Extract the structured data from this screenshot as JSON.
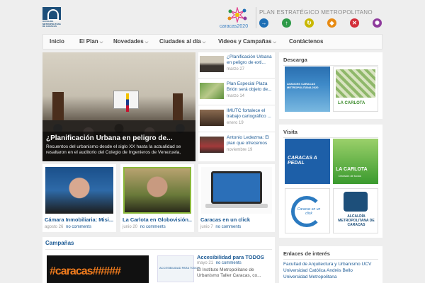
{
  "header": {
    "logo_text": "ALCALDÍA METROPOLITANA DE CARACAS",
    "plan_logo_text": "caracas2020",
    "plan_title": "PLAN ESTRATÉGICO METROPOLITANO",
    "plan_icons": [
      {
        "icon": "arrow-right-icon",
        "color": "#1e6fb5"
      },
      {
        "icon": "arrow-up-icon",
        "color": "#2e9a48"
      },
      {
        "icon": "cycle-icon",
        "color": "#c9b800"
      },
      {
        "icon": "diamond-up-icon",
        "color": "#e78a12"
      },
      {
        "icon": "cross-diamond-icon",
        "color": "#d32e3a"
      },
      {
        "icon": "gear-icon",
        "color": "#8e3a9c"
      }
    ]
  },
  "nav": {
    "items": [
      {
        "label": "Inicio",
        "has_dropdown": false
      },
      {
        "label": "El Plan",
        "has_dropdown": true
      },
      {
        "label": "Novedades",
        "has_dropdown": true
      },
      {
        "label": "Ciudades al día",
        "has_dropdown": true
      },
      {
        "label": "Videos y Campañas",
        "has_dropdown": true
      },
      {
        "label": "Contáctenos",
        "has_dropdown": false
      }
    ]
  },
  "featured": {
    "title": "¿Planificación Urbana en peligro de...",
    "excerpt": "Recuentos del urbanismo desde el siglo XX hasta la actualidad se resaltaron en el auditorio del Colegio de Ingenieros de Venezuela, donde se llevó a c..."
  },
  "side_list": [
    {
      "title": "¿Planificación Urbana en peligro de exti...",
      "date": "marzo 27"
    },
    {
      "title": "Plan Especial Plaza Brión será objeto de...",
      "date": "marzo 14"
    },
    {
      "title": "IMUTC fortalece el trabajo cartográfico ...",
      "date": "enero 19"
    },
    {
      "title": "Antonio Ledezma: El plan que ofrecemos e...",
      "date": "noviembre 19"
    }
  ],
  "videos": [
    {
      "title": "Cámara Inmobiliaria: Misi...",
      "date": "agosto 26",
      "comments": "no comments"
    },
    {
      "title": "La Carlota en Globovisión...",
      "date": "junio 20",
      "comments": "no comments"
    },
    {
      "title": "Caracas en un click",
      "date": "junio 7",
      "comments": "no comments"
    }
  ],
  "campaigns": {
    "heading": "Campañas",
    "image_text": "#caracas#####",
    "image2_text": "ACCESIBILIDAD PARA TODOS",
    "item_title": "Accesibilidad para TODOS",
    "item_date": "mayo 21",
    "item_comments": "no comments",
    "item_excerpt": "El Instituto Metropolitano de Urbanismo Taller Caracas, co..."
  },
  "sidebar": {
    "descarga": {
      "heading": "Descarga",
      "items": [
        {
          "label": "AVANCES CARACAS METROPOLITANA 2020"
        },
        {
          "label": "LA CARLOTA"
        }
      ]
    },
    "visita": {
      "heading": "Visita",
      "items": [
        {
          "label": "CARACAS A PEDAL"
        },
        {
          "label": "LA CARLOTA",
          "sub": "Decisión de todos"
        },
        {
          "label": "Caracas en un click"
        },
        {
          "label": "ALCALDÍA METROPOLITANA DE CARACAS"
        }
      ]
    },
    "enlaces": {
      "heading": "Enlaces de interés",
      "links": [
        "Facultad de Arquitectura y Urbanismo UCV",
        "Universidad Católica Andrés Bello",
        "Universidad Metropolitana"
      ]
    }
  }
}
